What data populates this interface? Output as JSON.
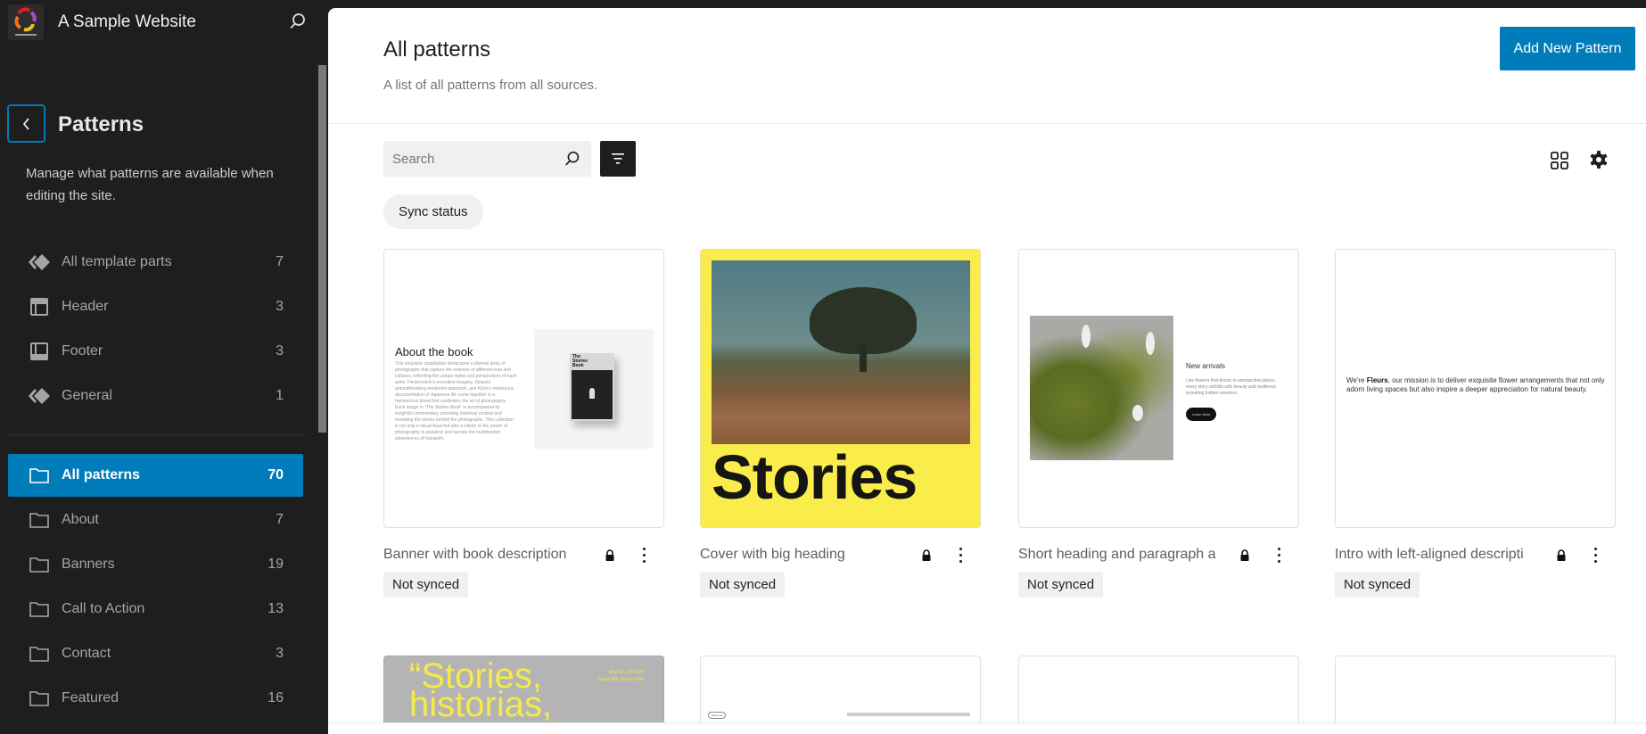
{
  "sidebar": {
    "site_title": "A Sample Website",
    "heading": "Patterns",
    "description": "Manage what patterns are available when editing the site.",
    "template_parts": [
      {
        "label": "All template parts",
        "count": "7",
        "icon": "symbol-filled-icon"
      },
      {
        "label": "Header",
        "count": "3",
        "icon": "header-layout-icon"
      },
      {
        "label": "Footer",
        "count": "3",
        "icon": "footer-layout-icon"
      },
      {
        "label": "General",
        "count": "1",
        "icon": "symbol-filled-icon"
      }
    ],
    "categories": [
      {
        "label": "All patterns",
        "count": "70",
        "active": true
      },
      {
        "label": "About",
        "count": "7"
      },
      {
        "label": "Banners",
        "count": "19"
      },
      {
        "label": "Call to Action",
        "count": "13"
      },
      {
        "label": "Contact",
        "count": "3"
      },
      {
        "label": "Featured",
        "count": "16"
      }
    ]
  },
  "header": {
    "title": "All patterns",
    "description": "A list of all patterns from all sources.",
    "add_button": "Add New Pattern"
  },
  "toolbar": {
    "search_placeholder": "Search",
    "sync_filter": "Sync status"
  },
  "patterns": [
    {
      "title": "Banner with book description",
      "status": "Not synced",
      "preview": {
        "heading": "About the book",
        "book_title": "The Stories Book",
        "body": "This exquisite compilation showcases a diverse array of photographs that capture the essence of different eras and cultures, reflecting the unique styles and perspectives of each artist. Fleckenstein's evocative imagery, Strand's groundbreaking modernist approach, and Kōno's meticulous documentation of Japanese life come together in a harmonious blend that celebrates the art of photography. Each image in \"The Stories Book\" is accompanied by insightful commentary, providing historical context and revealing the stories behind the photographs. This collection is not only a visual feast but also a tribute to the power of photography to preserve and narrate the multifaceted experiences of humanity."
      }
    },
    {
      "title": "Cover with big heading",
      "status": "Not synced",
      "preview": {
        "heading": "Stories"
      }
    },
    {
      "title": "Short heading and paragraph a",
      "status": "Not synced",
      "preview": {
        "heading": "New arrivals",
        "body": "Like flowers that bloom in unexpected places, every story unfolds with beauty and resilience, revealing hidden wonders.",
        "button": "Learn More"
      }
    },
    {
      "title": "Intro with left-aligned descripti",
      "status": "Not synced",
      "preview": {
        "pre": "We're ",
        "brand": "Fleurs",
        "body": ", our mission is to deliver exquisite flower arrangements that not only adorn living spaces but also inspire a deeper appreciation for natural beauty."
      }
    },
    {
      "preview": {
        "heading_line1": "“Stories,",
        "heading_line2": "historias,",
        "date": "Aug 08—10 2025",
        "venue": "Fuego Bar, Mexico City"
      }
    },
    {
      "preview": {
        "tag": "About Us"
      }
    },
    {
      "preview": {}
    },
    {
      "preview": {}
    }
  ],
  "colors": {
    "accent": "#007cba",
    "sidebar_bg": "#1e1e1e",
    "cover_yellow": "#f9ec4b"
  }
}
